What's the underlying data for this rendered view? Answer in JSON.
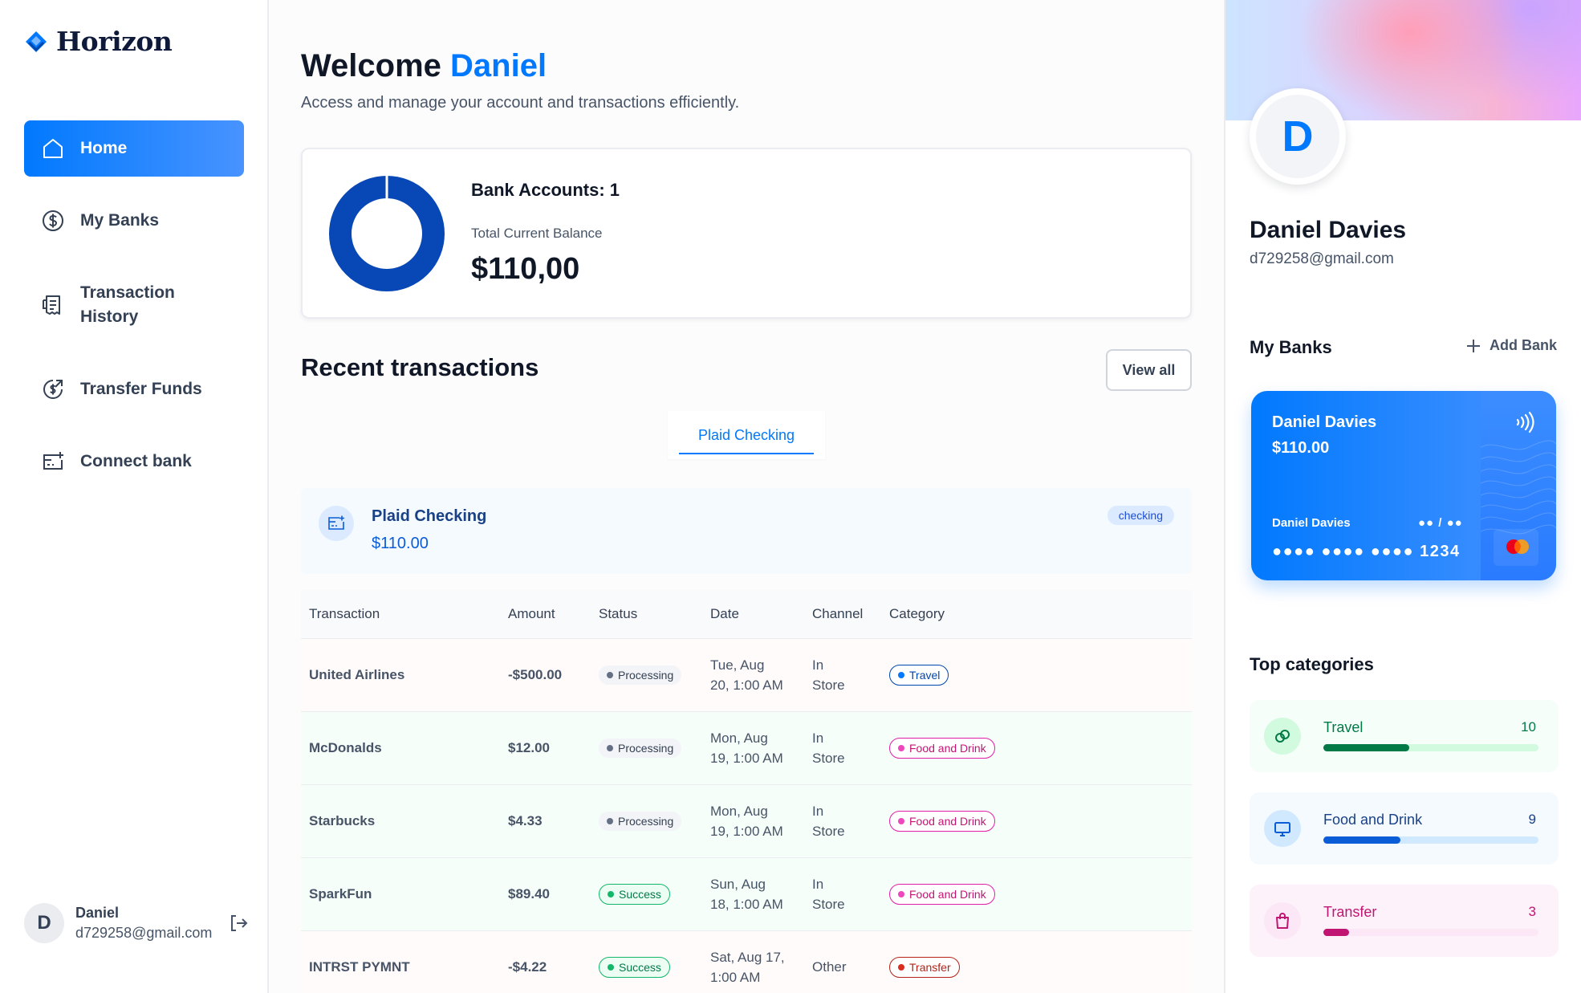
{
  "brand": {
    "name": "Horizon",
    "color": "#0179FE"
  },
  "sidebar": {
    "items": [
      {
        "label": "Home",
        "icon": "home-icon",
        "active": true
      },
      {
        "label": "My Banks",
        "icon": "dollar-circle-icon"
      },
      {
        "label": "Transaction\nHistory",
        "icon": "receipt-icon"
      },
      {
        "label": "Transfer Funds",
        "icon": "transfer-funds-icon"
      },
      {
        "label": "Connect bank",
        "icon": "connect-bank-icon"
      }
    ],
    "user": {
      "initial": "D",
      "name": "Daniel",
      "email": "d729258@gmail.com"
    }
  },
  "header": {
    "welcome": "Welcome",
    "name": "Daniel",
    "subtitle": "Access and manage your account and transactions efficiently."
  },
  "balance_card": {
    "accounts_label": "Bank Accounts: 1",
    "balance_label": "Total Current Balance",
    "balance": "$110,00",
    "chart_colors": [
      "#0747B6"
    ]
  },
  "recent": {
    "title": "Recent transactions",
    "view_all": "View all",
    "tab": "Plaid Checking",
    "account": {
      "name": "Plaid Checking",
      "balance": "$110.00",
      "type": "checking"
    },
    "columns": [
      "Transaction",
      "Amount",
      "Status",
      "Date",
      "Channel",
      "Category"
    ],
    "rows": [
      {
        "name": "United Airlines",
        "amount": "-$500.00",
        "type": "debit",
        "status": "Processing",
        "status_type": "processing",
        "date": "Tue, Aug\n20, 1:00 AM",
        "channel": "In\nStore",
        "category": "Travel",
        "cat_type": "travel"
      },
      {
        "name": "McDonalds",
        "amount": "$12.00",
        "type": "credit",
        "status": "Processing",
        "status_type": "processing",
        "date": "Mon, Aug\n19, 1:00 AM",
        "channel": "In\nStore",
        "category": "Food and Drink",
        "cat_type": "food"
      },
      {
        "name": "Starbucks",
        "amount": "$4.33",
        "type": "credit",
        "status": "Processing",
        "status_type": "processing",
        "date": "Mon, Aug\n19, 1:00 AM",
        "channel": "In\nStore",
        "category": "Food and Drink",
        "cat_type": "food"
      },
      {
        "name": "SparkFun",
        "amount": "$89.40",
        "type": "credit",
        "status": "Success",
        "status_type": "success",
        "date": "Sun, Aug\n18, 1:00 AM",
        "channel": "In\nStore",
        "category": "Food and Drink",
        "cat_type": "food"
      },
      {
        "name": "INTRST PYMNT",
        "amount": "-$4.22",
        "type": "debit",
        "status": "Success",
        "status_type": "success",
        "date": "Sat, Aug 17,\n1:00 AM",
        "channel": "Other",
        "category": "Transfer",
        "cat_type": "transfer"
      }
    ]
  },
  "profile": {
    "initial": "D",
    "name": "Daniel Davies",
    "email": "d729258@gmail.com"
  },
  "my_banks": {
    "title": "My Banks",
    "add_label": "Add Bank",
    "card": {
      "name": "Daniel Davies",
      "balance": "$110.00",
      "holder": "Daniel Davies",
      "expiry": "●● / ●●",
      "number": "●●●● ●●●● ●●●● 1234"
    }
  },
  "top_categories": {
    "title": "Top categories",
    "items": [
      {
        "name": "Travel",
        "count": "10",
        "fraction": 0.4,
        "bg": "#F6FEF9",
        "track": "#D1FADF",
        "fill": "#027A48",
        "text": "#027A48",
        "icon_bg": "#D1FADF",
        "icon": "link-icon"
      },
      {
        "name": "Food and Drink",
        "count": "9",
        "fraction": 0.36,
        "bg": "#F5FAFF",
        "track": "#D1E9FF",
        "fill": "#0B5CD7",
        "text": "#194185",
        "icon_bg": "#D1E9FF",
        "icon": "monitor-icon"
      },
      {
        "name": "Transfer",
        "count": "3",
        "fraction": 0.12,
        "bg": "#FDF2FA",
        "track": "#FCE7F6",
        "fill": "#C11574",
        "text": "#C11574",
        "icon_bg": "#FCE7F6",
        "icon": "shopping-bag-icon"
      }
    ]
  }
}
